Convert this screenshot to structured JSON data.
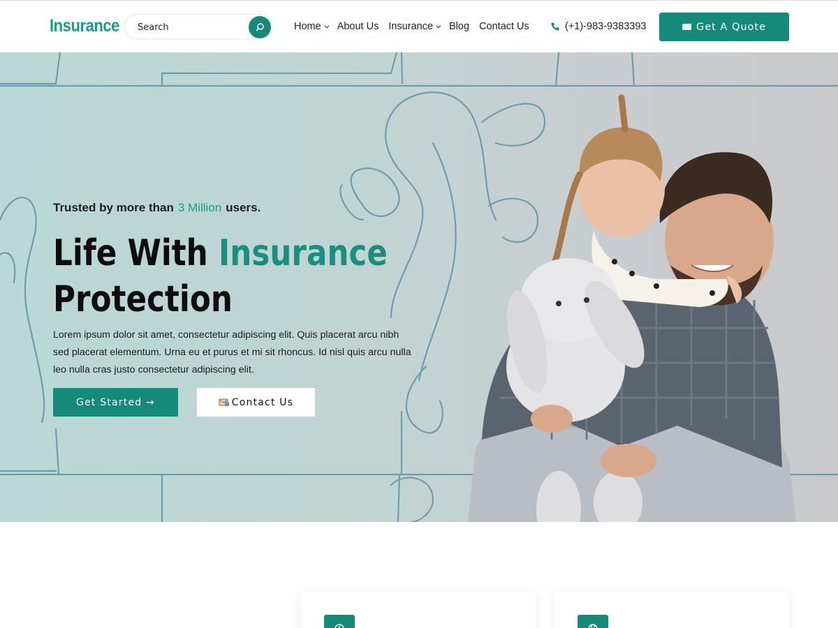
{
  "header": {
    "logo": "Insurance",
    "search_placeholder": "Search",
    "nav": [
      {
        "label": "Home",
        "dropdown": true
      },
      {
        "label": "About Us",
        "dropdown": false
      },
      {
        "label": "Insurance",
        "dropdown": true
      },
      {
        "label": "Blog",
        "dropdown": false
      },
      {
        "label": "Contact Us",
        "dropdown": false
      }
    ],
    "phone": "(+1)-983-9383393",
    "quote_label": "Get A Quote"
  },
  "hero": {
    "trusted_prefix": "Trusted by more than",
    "trusted_highlight": "3 Million",
    "trusted_suffix": "users.",
    "headline_part1": "Life With",
    "headline_accent": "Insurance",
    "headline_part2": "Protection",
    "description": "Lorem ipsum dolor sit amet, consectetur adipiscing elit. Quis placerat arcu nibh sed placerat elementum. Urna eu et purus et mi sit rhoncus. Id nisl quis arcu nulla leo nulla cras justo consectetur adipiscing elit.",
    "start_label": "Get Started →",
    "contact_label": "Contact Us"
  },
  "features": {
    "icons": [
      "clock-icon",
      "globe-icon"
    ]
  },
  "colors": {
    "brand": "#168a7a",
    "accent_text": "#1a9a8a",
    "hero_bg_left": "#b9d8d5",
    "hero_bg_right": "#c9c9cb"
  }
}
